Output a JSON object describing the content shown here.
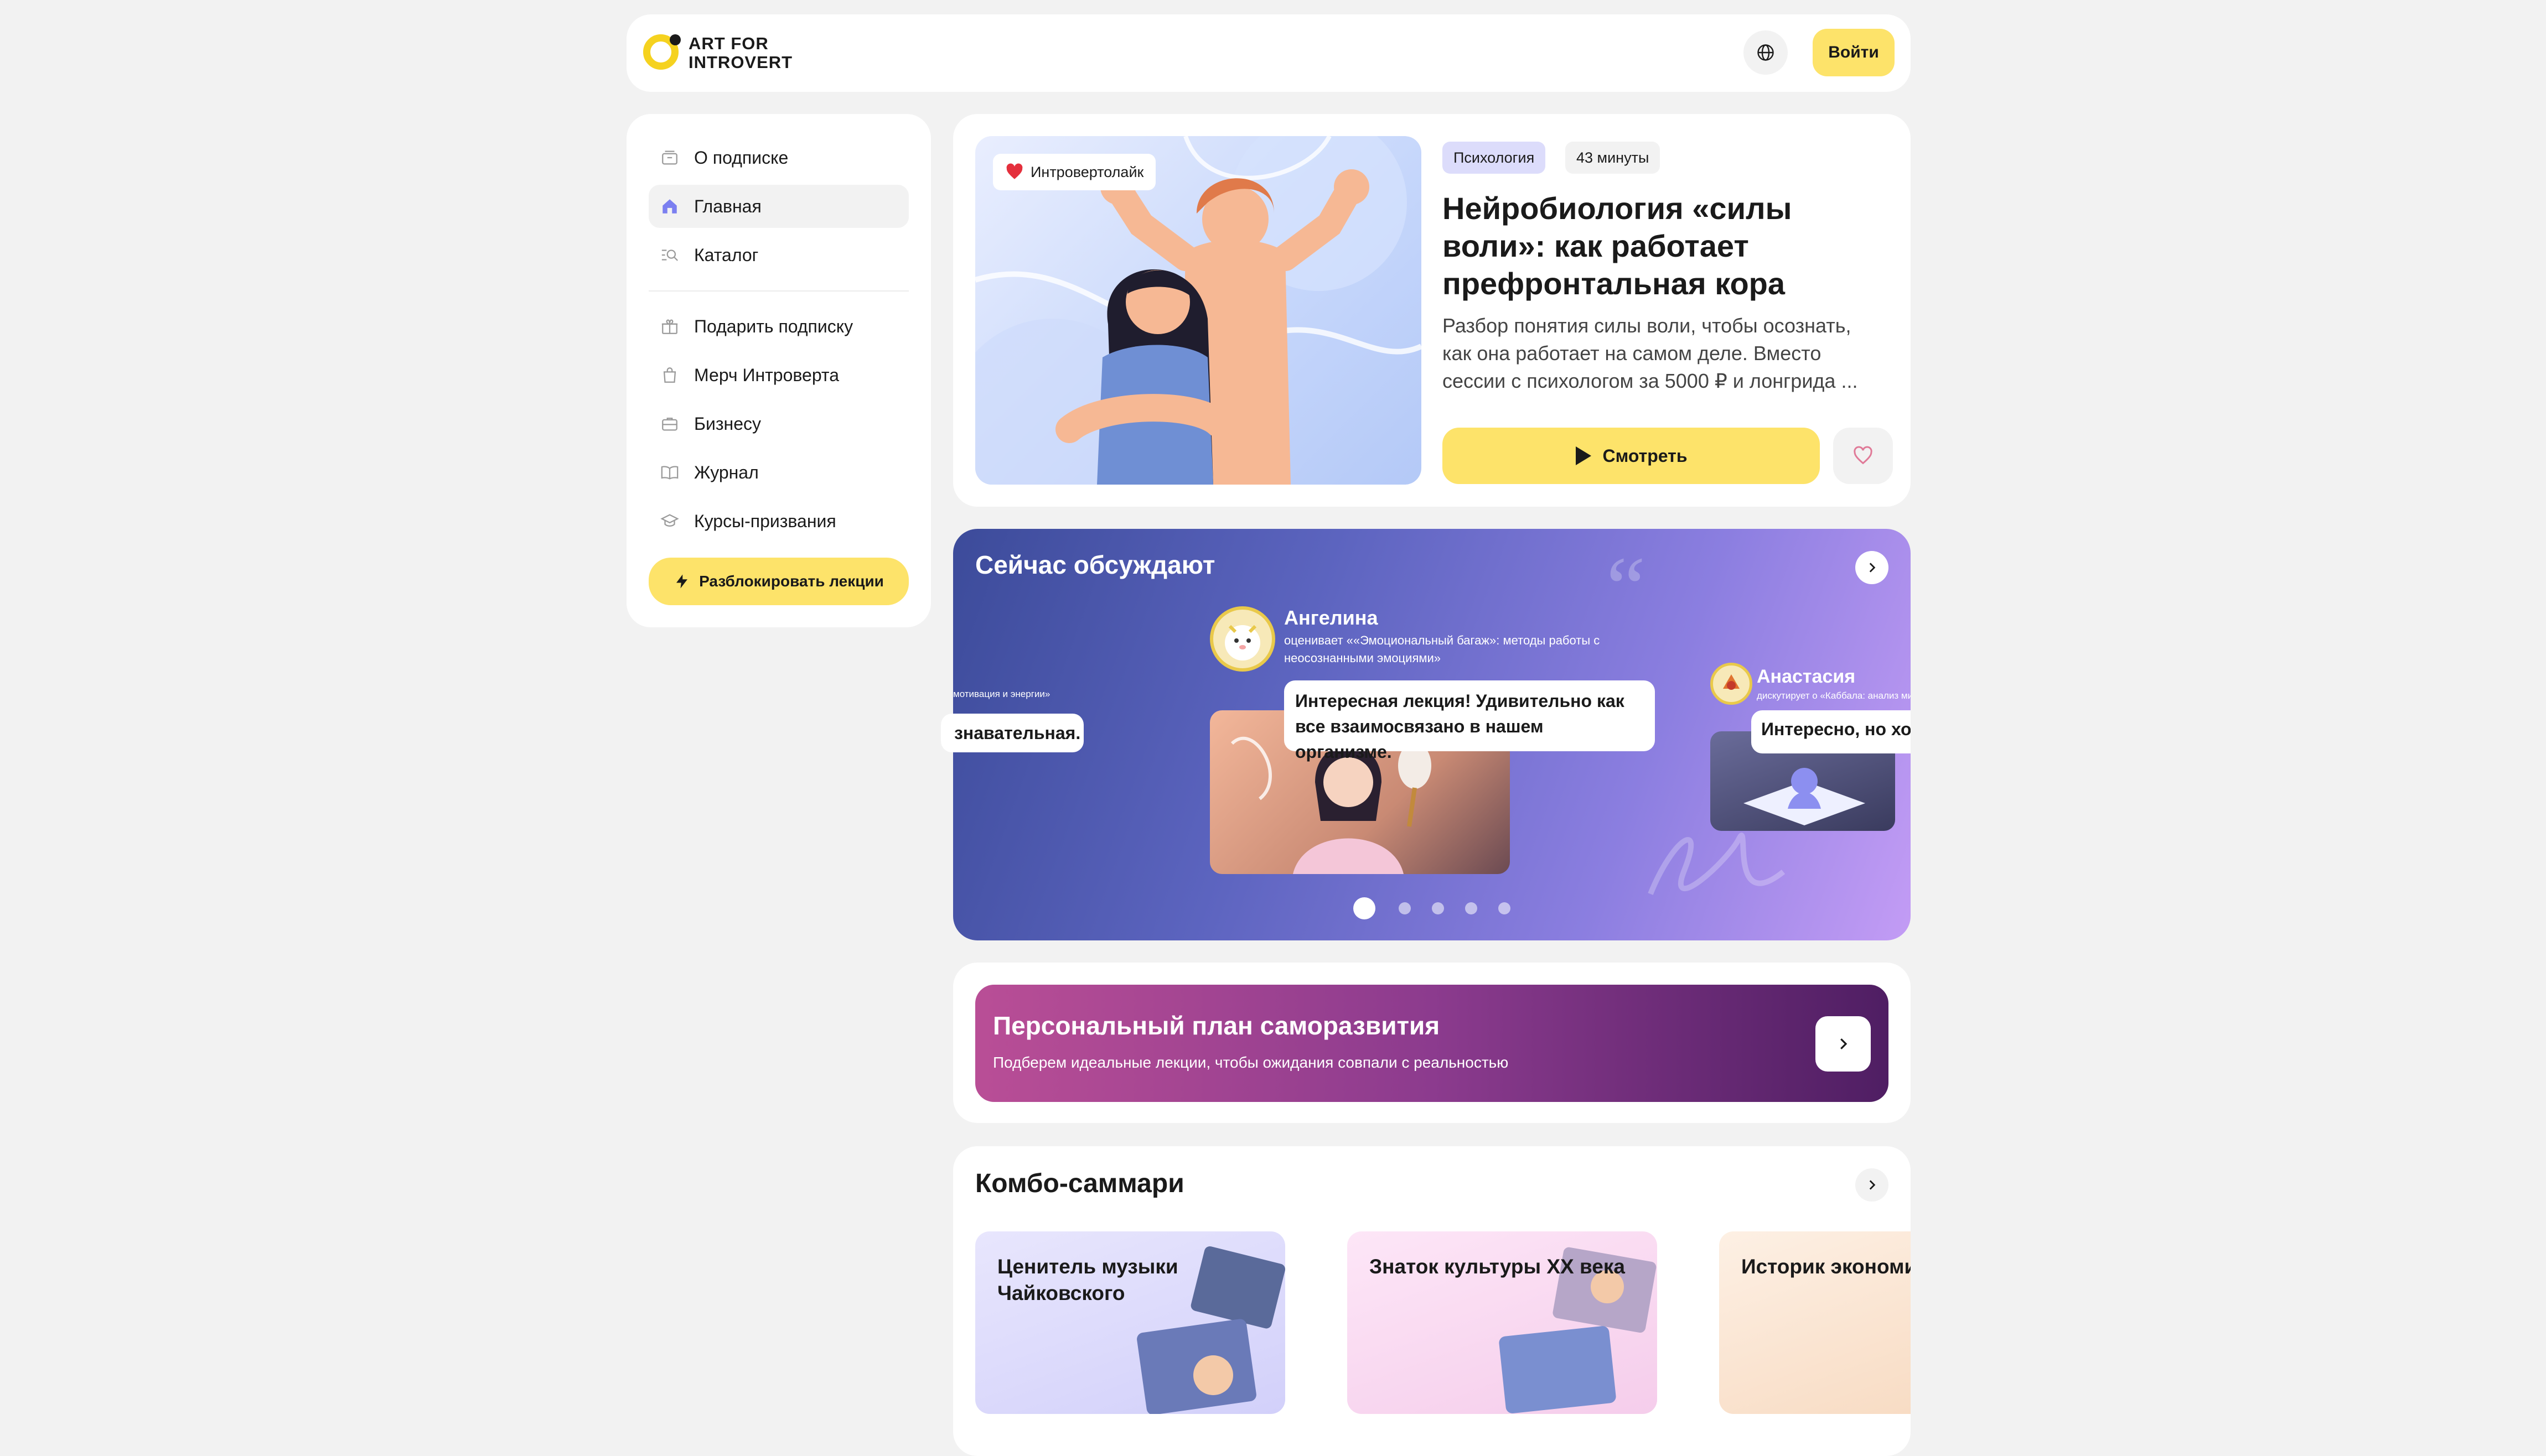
{
  "header": {
    "logo_line1": "ART FOR",
    "logo_line2": "INTROVERT",
    "login_label": "Войти",
    "globe_icon": "globe-icon"
  },
  "sidebar": {
    "items": [
      {
        "label": "О подписке",
        "icon": "subscription-icon"
      },
      {
        "label": "Главная",
        "icon": "home-icon",
        "active": true
      },
      {
        "label": "Каталог",
        "icon": "catalog-search-icon"
      },
      {
        "label": "Подарить подписку",
        "icon": "gift-icon"
      },
      {
        "label": "Мерч Интроверта",
        "icon": "shopping-bag-icon"
      },
      {
        "label": "Бизнесу",
        "icon": "briefcase-icon"
      },
      {
        "label": "Журнал",
        "icon": "book-icon"
      },
      {
        "label": "Курсы-призвания",
        "icon": "graduation-cap-icon"
      }
    ],
    "unlock_label": "Разблокировать лекции"
  },
  "featured": {
    "badge_label": "Интровертолайк",
    "tag_category": "Психология",
    "tag_duration": "43 минуты",
    "title": "Нейробиология «силы воли»: как работает префронтальная кора",
    "description": "Разбор понятия силы воли, чтобы осознать, как она работает на самом деле. Вместо сессии с психологом за 5000 ₽ и лонгрида ...",
    "watch_label": "Смотреть"
  },
  "discussion": {
    "title": "Сейчас обсуждают",
    "left_subtext": "мотивация и энергии»",
    "left_comment": "знавательная.",
    "center_user": "Ангелина",
    "center_action": "оценивает «‎«Эмоциональный багаж»: методы работы с неосознанными эмоциями»",
    "center_comment": "Интересная лекция! Удивительно как все взаимосвязано в нашем организме.",
    "right_user": "Анастасия",
    "right_action": "дискутирует о «Каббала: анализ ми",
    "right_comment": "Интересно, но хо",
    "pages": 5,
    "active_page": 1
  },
  "plan": {
    "title": "Персональный план саморазвития",
    "subtitle": "Подберем идеальные лекции, чтобы ожидания совпали с реальностью"
  },
  "combo": {
    "title": "Комбо-саммари",
    "cards": [
      {
        "title": "Ценитель музыки Чайковского"
      },
      {
        "title": "Знаток культуры XX века"
      },
      {
        "title": "Историк экономи институтов"
      }
    ]
  },
  "colors": {
    "accent_yellow": "#fde36a",
    "background": "#f2f2f2",
    "discussion_gradient_start": "#3c4b9a",
    "discussion_gradient_end": "#c39cf5",
    "plan_gradient_start": "#b94e96",
    "plan_gradient_end": "#4f1e63"
  }
}
